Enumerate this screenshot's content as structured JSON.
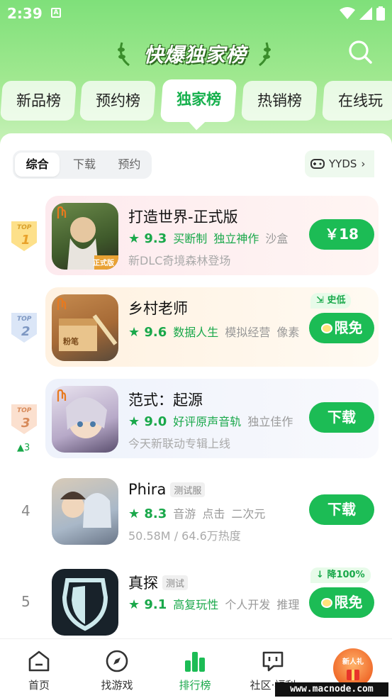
{
  "status_bar": {
    "time": "2:39",
    "a_glyph": "A"
  },
  "header": {
    "title": "快爆独家榜"
  },
  "tabs": [
    {
      "label": "新品榜"
    },
    {
      "label": "预约榜"
    },
    {
      "label": "独家榜"
    },
    {
      "label": "热销榜"
    },
    {
      "label": "在线玩"
    }
  ],
  "active_tab": "独家榜",
  "filter": {
    "options": [
      "综合",
      "下载",
      "预约"
    ],
    "selected": "综合"
  },
  "yyds": {
    "label": "YYDS"
  },
  "games": [
    {
      "rank_badge": "TOP",
      "rank": "1",
      "title": "打造世界-正式版",
      "badge": "",
      "score": "9.3",
      "tags_green": [
        "买断制",
        "独立神作"
      ],
      "tags_gray": [
        "沙盒"
      ],
      "subtitle": "新DLC奇境森林登场",
      "button": "￥18",
      "button_tag": "",
      "icon_caption": "正式版",
      "accent": "#fdeef0"
    },
    {
      "rank_badge": "TOP",
      "rank": "2",
      "title": "乡村老师",
      "badge": "",
      "score": "9.6",
      "tags_green": [
        "数据人生"
      ],
      "tags_gray": [
        "模拟经营",
        "像素"
      ],
      "subtitle": "",
      "button": "限免",
      "button_tag": "史低",
      "icon_caption": "粉笔",
      "accent": "#fff5e8"
    },
    {
      "rank_badge": "TOP",
      "rank": "3",
      "rank_change": "3",
      "title": "范式：起源",
      "badge": "",
      "score": "9.0",
      "tags_green": [
        "好评原声音轨"
      ],
      "tags_gray": [
        "独立佳作"
      ],
      "subtitle": "今天新联动专辑上线",
      "button": "下载",
      "button_tag": "",
      "accent": "#f3f6fd"
    },
    {
      "rank": "4",
      "title": "Phira",
      "badge": "测试服",
      "score": "8.3",
      "tags_green": [],
      "tags_gray": [
        "音游",
        "点击",
        "二次元"
      ],
      "subtitle": "50.58M / 64.6万热度",
      "button": "下载",
      "button_tag": ""
    },
    {
      "rank": "5",
      "title": "真探",
      "badge": "测试",
      "score": "9.1",
      "tags_green": [
        "高复玩性"
      ],
      "tags_gray": [
        "个人开发",
        "推理"
      ],
      "subtitle": "",
      "button": "限免",
      "button_tag": "降100%"
    }
  ],
  "bottom_nav": [
    {
      "label": "首页",
      "icon": "home-icon"
    },
    {
      "label": "找游戏",
      "icon": "compass-icon"
    },
    {
      "label": "排行榜",
      "icon": "bar-chart-icon"
    },
    {
      "label": "社区·福利",
      "icon": "chat-icon"
    }
  ],
  "gift": {
    "label": "新人礼"
  },
  "watermark": "www.macnode.com",
  "colors": {
    "brand_green": "#1cbc55",
    "hero_green": "#7fe07a"
  }
}
